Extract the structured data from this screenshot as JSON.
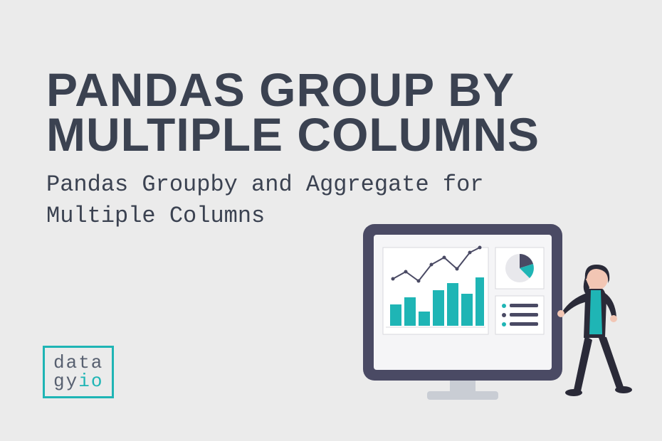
{
  "title_line1": "Pandas Group By",
  "title_line2": "Multiple Columns",
  "subtitle": "Pandas Groupby and Aggregate for Multiple Columns",
  "logo": {
    "row1": "data",
    "row2_a": "gy",
    "row2_b": "io"
  }
}
